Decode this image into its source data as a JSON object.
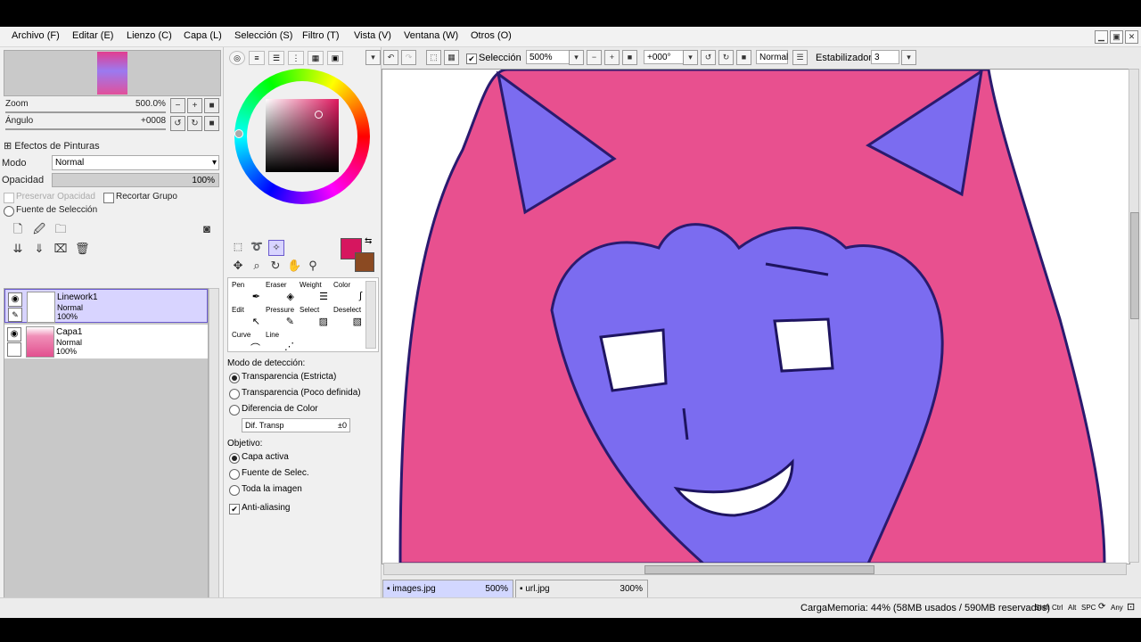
{
  "menu": [
    "Archivo (F)",
    "Editar (E)",
    "Lienzo (C)",
    "Capa (L)",
    "Selección (S)",
    "Filtro (T)",
    "Vista (V)",
    "Ventana (W)",
    "Otros (O)"
  ],
  "navigator": {
    "zoom_label": "Zoom",
    "zoom_value": "500.0%",
    "angle_label": "Ángulo",
    "angle_value": "+0008"
  },
  "paint_effects": {
    "title": "Efectos de Pinturas",
    "mode_label": "Modo",
    "mode_value": "Normal",
    "opacity_label": "Opacidad",
    "opacity_value": "100%",
    "preserve_opacity": "Preservar Opacidad",
    "clip_group": "Recortar Grupo",
    "selection_source": "Fuente de Selección"
  },
  "layers": [
    {
      "name": "Linework1",
      "mode": "Normal",
      "opacity": "100%",
      "selected": true
    },
    {
      "name": "Capa1",
      "mode": "Normal",
      "opacity": "100%",
      "selected": false
    }
  ],
  "tools": {
    "row1": [
      "Pen",
      "Eraser",
      "Weight",
      "Color"
    ],
    "row2": [
      "Edit",
      "Pressure",
      "Select",
      "Deselect"
    ],
    "row3": [
      "Curve",
      "Line"
    ]
  },
  "colors": {
    "primary": "#d6165f",
    "secondary": "#8b4a22",
    "canvas_hair": "#e8508f",
    "canvas_skin": "#7b6cf0"
  },
  "magic_wand": {
    "detection_label": "Modo de detección:",
    "detection_options": [
      "Transparencia (Estricta)",
      "Transparencia (Poco definida)",
      "Diferencia de Color"
    ],
    "detection_selected": 0,
    "tolerance_label": "Dif. Transp",
    "tolerance_value": "±0",
    "target_label": "Objetivo:",
    "target_options": [
      "Capa activa",
      "Fuente de Selec.",
      "Toda la imagen"
    ],
    "target_selected": 0,
    "antialias_label": "Anti-aliasing"
  },
  "toolbar": {
    "selection_label": "Selección",
    "zoom": "500%",
    "angle": "+000°",
    "blend": "Normal",
    "stabilizer_label": "Estabilizador",
    "stabilizer_value": "3"
  },
  "documents": [
    {
      "name": "images.jpg",
      "zoom": "500%",
      "active": true
    },
    {
      "name": "url.jpg",
      "zoom": "300%",
      "active": false
    }
  ],
  "status": {
    "memory": "CargaMemoria: 44% (58MB usados / 590MB reservados)",
    "keys": [
      "Shift",
      "Ctrl",
      "Alt",
      "SPC"
    ],
    "any": "Any"
  }
}
